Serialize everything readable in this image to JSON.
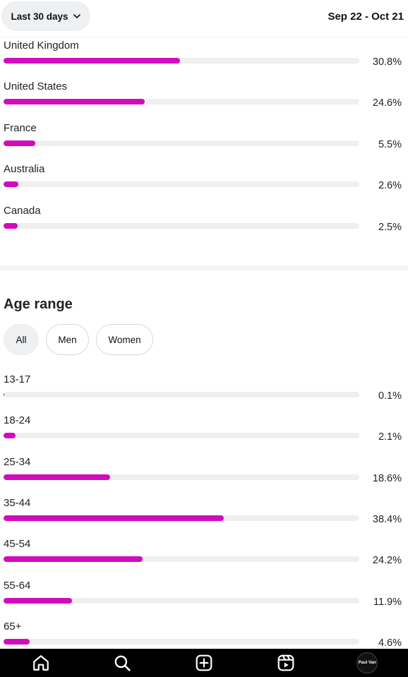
{
  "header": {
    "range_label": "Last 30 days",
    "date_range": "Sep 22 - Oct 21"
  },
  "countries": [
    {
      "name": "United Kingdom",
      "percent_label": "30.8%",
      "percent": 30.8
    },
    {
      "name": "United States",
      "percent_label": "24.6%",
      "percent": 24.6
    },
    {
      "name": "France",
      "percent_label": "5.5%",
      "percent": 5.5
    },
    {
      "name": "Australia",
      "percent_label": "2.6%",
      "percent": 2.6
    },
    {
      "name": "Canada",
      "percent_label": "2.5%",
      "percent": 2.5
    }
  ],
  "age_section": {
    "title": "Age range",
    "filters": [
      {
        "label": "All",
        "active": true
      },
      {
        "label": "Men",
        "active": false
      },
      {
        "label": "Women",
        "active": false
      }
    ],
    "ranges": [
      {
        "label": "13-17",
        "percent_label": "0.1%",
        "percent": 0.1
      },
      {
        "label": "18-24",
        "percent_label": "2.1%",
        "percent": 2.1
      },
      {
        "label": "25-34",
        "percent_label": "18.6%",
        "percent": 18.6
      },
      {
        "label": "35-44",
        "percent_label": "38.4%",
        "percent": 38.4
      },
      {
        "label": "45-54",
        "percent_label": "24.2%",
        "percent": 24.2
      },
      {
        "label": "55-64",
        "percent_label": "11.9%",
        "percent": 11.9
      },
      {
        "label": "65+",
        "percent_label": "4.6%",
        "percent": 4.6
      }
    ]
  },
  "bottom_nav": {
    "items": [
      "home-icon",
      "search-icon",
      "create-icon",
      "reels-icon",
      "profile-avatar"
    ],
    "avatar_text": "Paul Van"
  },
  "colors": {
    "bar": "#d20cbe",
    "track": "#efefef"
  }
}
